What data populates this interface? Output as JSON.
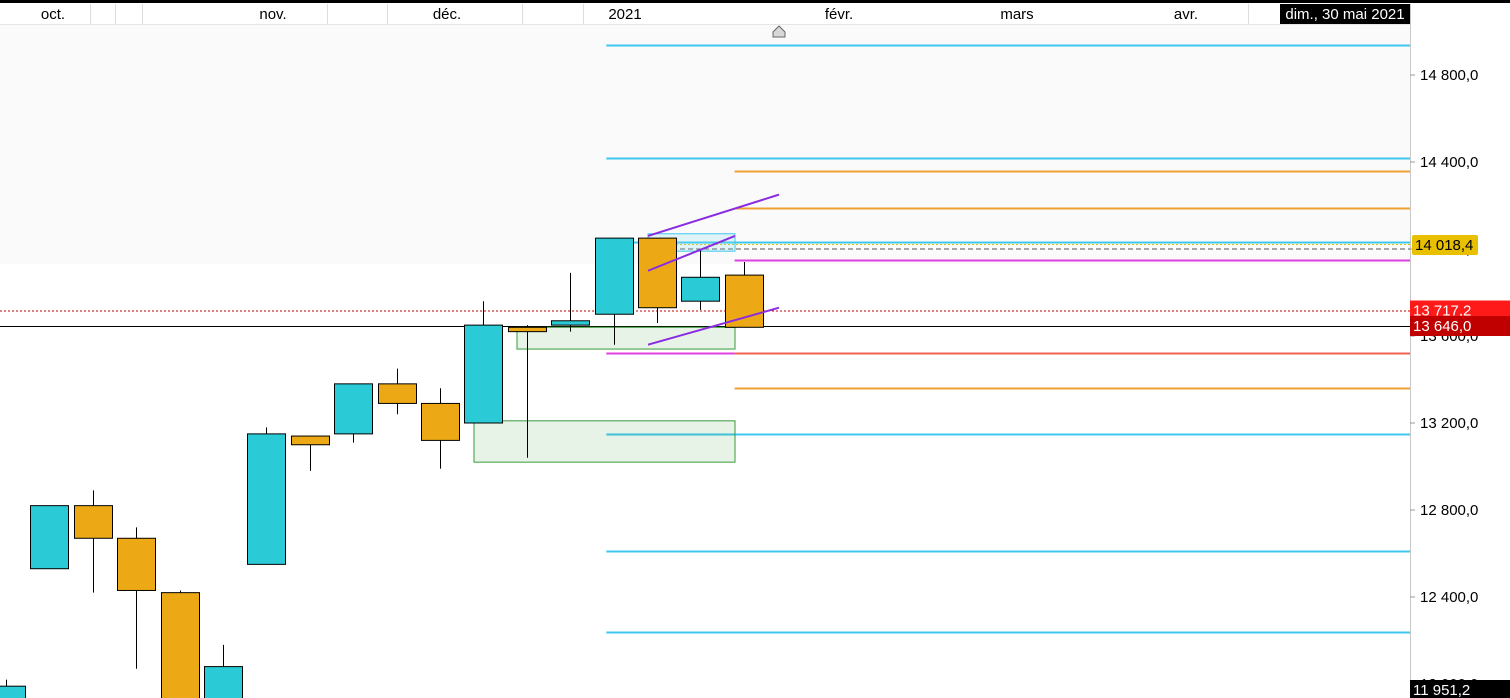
{
  "chart_data": {
    "type": "candlestick",
    "months": [
      "oct.",
      "nov.",
      "déc.",
      "2021",
      "févr.",
      "mars",
      "avr."
    ],
    "cursor_date": "dim., 30 mai 2021",
    "y_ticks": [
      "14 800,0",
      "14 400,0",
      "14 000,0",
      "13 600,0",
      "13 200,0",
      "12 800,0",
      "12 400,0",
      "12 000,0"
    ],
    "y_tick_values": [
      14800,
      14400,
      14000,
      13600,
      13200,
      12800,
      12400,
      12000
    ],
    "ylim": [
      11951.2,
      15000
    ],
    "price_labels": [
      {
        "text": "14 018,4",
        "value": 14018.4,
        "bg": "#e8c000",
        "fg": "#000000"
      },
      {
        "text": "13 717,2",
        "value": 13717.2,
        "bg": "#ff1a1a",
        "fg": "#ffffff"
      },
      {
        "text": "13 646,0",
        "value": 13646.0,
        "bg": "#c00000",
        "fg": "#ffffff"
      },
      {
        "text": "11 951,2",
        "value": 11951.2,
        "bg": "#000000",
        "fg": "#ffffff"
      }
    ],
    "candles": [
      {
        "open": 11850,
        "high": 12020,
        "low": 11820,
        "close": 11990
      },
      {
        "open": 12530,
        "high": 12810,
        "low": 12550,
        "close": 12820
      },
      {
        "open": 12820,
        "high": 12890,
        "low": 12420,
        "close": 12670
      },
      {
        "open": 12670,
        "high": 12720,
        "low": 12070,
        "close": 12430
      },
      {
        "open": 12420,
        "high": 12430,
        "low": 11920,
        "close": 11920
      },
      {
        "open": 11920,
        "high": 12180,
        "low": 11920,
        "close": 12080
      },
      {
        "open": 12550,
        "high": 13180,
        "low": 12550,
        "close": 13150
      },
      {
        "open": 13140,
        "high": 13080,
        "low": 12980,
        "close": 13100
      },
      {
        "open": 13150,
        "high": 13380,
        "low": 13110,
        "close": 13380
      },
      {
        "open": 13380,
        "high": 13450,
        "low": 13240,
        "close": 13290
      },
      {
        "open": 13290,
        "high": 13360,
        "low": 12990,
        "close": 13120
      },
      {
        "open": 13200,
        "high": 13760,
        "low": 13200,
        "close": 13650
      },
      {
        "open": 13640,
        "high": 13650,
        "low": 13040,
        "close": 13620
      },
      {
        "open": 13650,
        "high": 13890,
        "low": 13620,
        "close": 13670
      },
      {
        "open": 13700,
        "high": 14040,
        "low": 13560,
        "close": 14050
      },
      {
        "open": 14050,
        "high": 14050,
        "low": 13660,
        "close": 13730
      },
      {
        "open": 13760,
        "high": 14000,
        "low": 13720,
        "close": 13870
      },
      {
        "open": 13880,
        "high": 13940,
        "low": 13640,
        "close": 13640
      }
    ],
    "h_lines": [
      {
        "value": 14940,
        "color": "#3ec7ef",
        "from": 0.43
      },
      {
        "value": 14420,
        "color": "#3ec7ef",
        "from": 0.43
      },
      {
        "value": 14360,
        "color": "#f0a030",
        "from": 0.521
      },
      {
        "value": 14190,
        "color": "#f0a030",
        "from": 0.521
      },
      {
        "value": 14030,
        "color": "#3ec7ef",
        "from": 0.43
      },
      {
        "value": 13950,
        "color": "#e040e0",
        "from": 0.521
      },
      {
        "value": 13520,
        "color": "#e040e0",
        "from": 0.43,
        "to": 0.521
      },
      {
        "value": 13520,
        "color": "#f06050",
        "from": 0.521
      },
      {
        "value": 13360,
        "color": "#f0a030",
        "from": 0.521
      },
      {
        "value": 13150,
        "color": "#3ec7ef",
        "from": 0.43
      },
      {
        "value": 12610,
        "color": "#3ec7ef",
        "from": 0.43
      },
      {
        "value": 12240,
        "color": "#3ec7ef",
        "from": 0.43
      }
    ]
  }
}
